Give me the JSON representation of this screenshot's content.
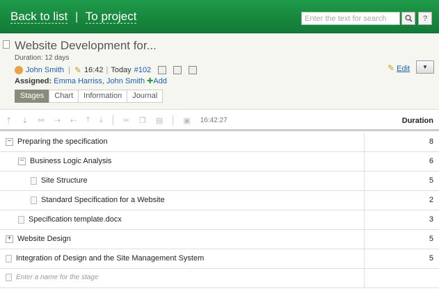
{
  "header": {
    "back_label": "Back to list",
    "separator": "|",
    "project_label": "To project",
    "search_placeholder": "Enter the text for search",
    "help_label": "?"
  },
  "task": {
    "title": "Website Development for...",
    "duration": "Duration: 12 days",
    "owner": "John Smith",
    "time": "16:42",
    "date": "Today",
    "number": "#102",
    "assigned_label": "Assigned:",
    "assignees": [
      "Emma Harriss,",
      "John Smith"
    ],
    "add_label": "Add",
    "edit_label": "Edit"
  },
  "tabs": [
    {
      "label": "Stages",
      "active": true
    },
    {
      "label": "Chart",
      "active": false
    },
    {
      "label": "Information",
      "active": false
    },
    {
      "label": "Journal",
      "active": false
    }
  ],
  "toolbar": {
    "time": "16:42:27",
    "column_header": "Duration"
  },
  "rows": [
    {
      "name": "Preparing the specification",
      "value": "8",
      "level": 0,
      "icon": "collapse-icon"
    },
    {
      "name": "Business Logic Analysis",
      "value": "6",
      "level": 1,
      "icon": "collapse-icon"
    },
    {
      "name": "Site Structure",
      "value": "5",
      "level": 2,
      "icon": "document-icon"
    },
    {
      "name": "Standard Specification for a Website",
      "value": "2",
      "level": 2,
      "icon": "document-icon"
    },
    {
      "name": "Specification template.docx",
      "value": "3",
      "level": 1,
      "icon": "document-icon"
    },
    {
      "name": "Website Design",
      "value": "5",
      "level": 0,
      "icon": "expand-icon"
    },
    {
      "name": "Integration of Design and the Site Management System",
      "value": "5",
      "level": 0,
      "icon": "document-icon"
    }
  ],
  "new_stage_placeholder": "Enter a name for the stage"
}
